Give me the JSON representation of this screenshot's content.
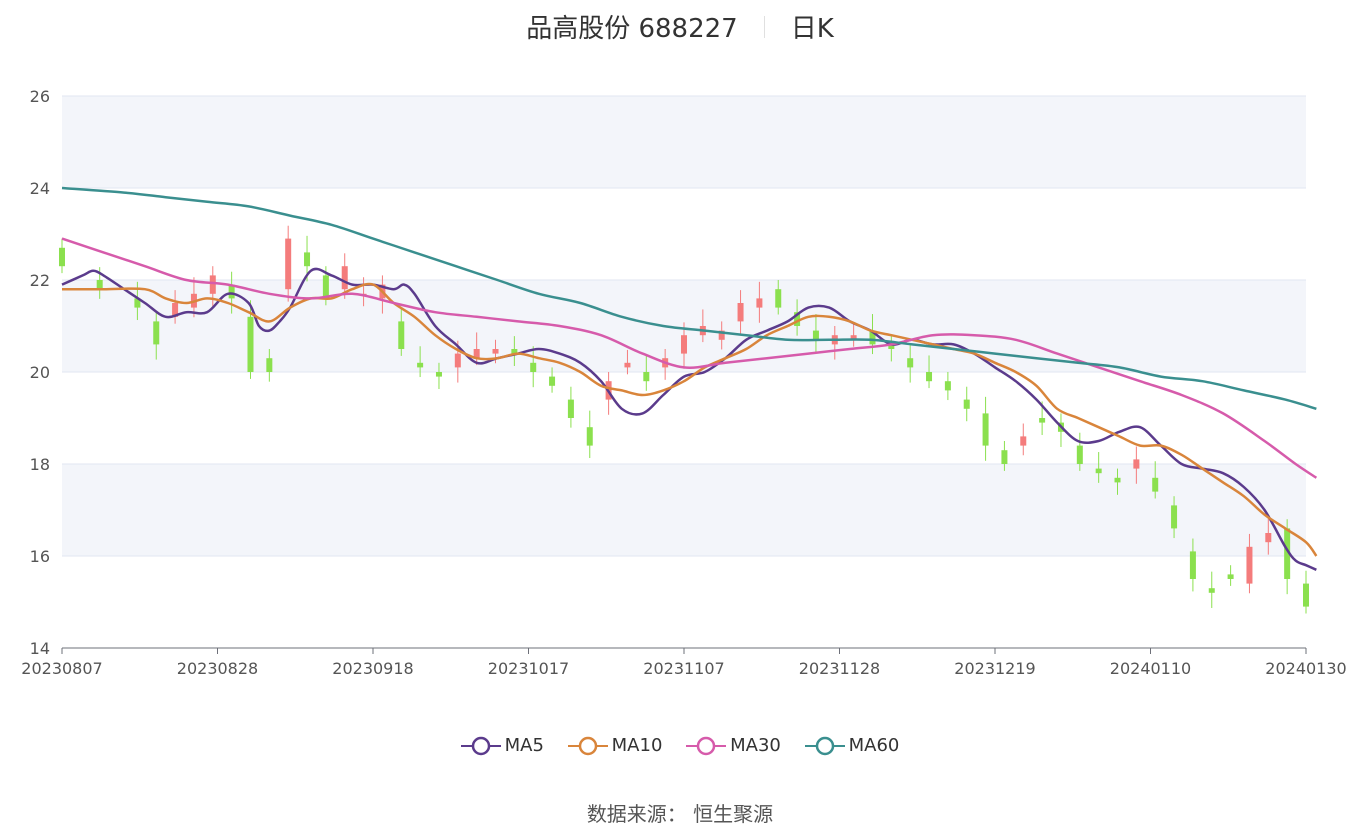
{
  "title": {
    "name": "品高股份 688227",
    "period": "日K"
  },
  "legend": [
    {
      "label": "MA5",
      "color": "#5b3b8c"
    },
    {
      "label": "MA10",
      "color": "#d9853b"
    },
    {
      "label": "MA30",
      "color": "#d65bab"
    },
    {
      "label": "MA60",
      "color": "#3a8f8f"
    }
  ],
  "source": {
    "label": "数据来源：",
    "value": "恒生聚源"
  },
  "colors": {
    "up": "#f47c7c",
    "down": "#8be04e",
    "band": "#f3f5fa",
    "grid": "#e0e6f1"
  },
  "chart_data": {
    "type": "candlestick",
    "ylim": [
      14,
      26
    ],
    "yticks": [
      14,
      16,
      18,
      20,
      22,
      24,
      26
    ],
    "xtick_labels": [
      "20230807",
      "20230828",
      "20230918",
      "20231017",
      "20231107",
      "20231128",
      "20231219",
      "20240110",
      "20240130"
    ],
    "xtick_indices": [
      0,
      15,
      30,
      45,
      60,
      75,
      90,
      105,
      120
    ],
    "num_days": 121,
    "candle_anchors": [
      [
        0,
        22.7,
        22.3
      ],
      [
        4,
        22.0,
        21.8
      ],
      [
        8,
        21.6,
        21.4
      ],
      [
        10,
        21.1,
        20.6
      ],
      [
        12,
        21.2,
        21.5
      ],
      [
        14,
        21.4,
        21.7
      ],
      [
        16,
        21.7,
        22.1
      ],
      [
        18,
        21.9,
        21.6
      ],
      [
        20,
        21.2,
        20.0
      ],
      [
        22,
        20.3,
        20.0
      ],
      [
        24,
        21.8,
        22.9
      ],
      [
        26,
        22.6,
        22.3
      ],
      [
        28,
        22.1,
        21.6
      ],
      [
        30,
        21.8,
        22.3
      ],
      [
        32,
        21.7,
        21.7
      ],
      [
        34,
        21.6,
        21.9
      ],
      [
        36,
        21.1,
        20.5
      ],
      [
        38,
        20.2,
        20.1
      ],
      [
        40,
        20.0,
        19.9
      ],
      [
        42,
        20.1,
        20.4
      ],
      [
        44,
        20.3,
        20.5
      ],
      [
        46,
        20.4,
        20.5
      ],
      [
        48,
        20.5,
        20.4
      ],
      [
        50,
        20.2,
        20.0
      ],
      [
        52,
        19.9,
        19.7
      ],
      [
        54,
        19.4,
        19.0
      ],
      [
        56,
        18.8,
        18.4
      ],
      [
        58,
        19.4,
        19.8
      ],
      [
        60,
        20.1,
        20.2
      ],
      [
        62,
        20.0,
        19.8
      ],
      [
        64,
        20.1,
        20.3
      ],
      [
        66,
        20.4,
        20.8
      ],
      [
        68,
        20.8,
        21.0
      ],
      [
        70,
        20.7,
        20.9
      ],
      [
        72,
        21.1,
        21.5
      ],
      [
        74,
        21.4,
        21.6
      ],
      [
        76,
        21.8,
        21.4
      ],
      [
        78,
        21.3,
        21.0
      ],
      [
        80,
        20.9,
        20.7
      ],
      [
        82,
        20.6,
        20.8
      ],
      [
        84,
        20.7,
        20.8
      ],
      [
        86,
        20.9,
        20.6
      ],
      [
        88,
        20.6,
        20.5
      ],
      [
        90,
        20.3,
        20.1
      ],
      [
        92,
        20.0,
        19.8
      ],
      [
        94,
        19.8,
        19.6
      ],
      [
        96,
        19.4,
        19.2
      ],
      [
        98,
        19.1,
        18.4
      ],
      [
        100,
        18.3,
        18.0
      ],
      [
        102,
        18.4,
        18.6
      ],
      [
        104,
        19.0,
        18.9
      ],
      [
        106,
        18.9,
        18.7
      ],
      [
        108,
        18.4,
        18.0
      ],
      [
        110,
        17.9,
        17.8
      ],
      [
        112,
        17.7,
        17.6
      ],
      [
        114,
        17.9,
        18.1
      ],
      [
        116,
        17.7,
        17.4
      ],
      [
        118,
        17.1,
        16.6
      ],
      [
        120,
        16.1,
        15.5
      ],
      [
        122,
        15.3,
        15.2
      ],
      [
        124,
        15.6,
        15.5
      ],
      [
        126,
        15.4,
        16.2
      ],
      [
        128,
        16.3,
        16.5
      ],
      [
        130,
        16.6,
        15.5
      ],
      [
        132,
        15.4,
        14.9
      ]
    ],
    "series": [
      {
        "name": "MA5",
        "points": [
          [
            0,
            21.9
          ],
          [
            2,
            22.1
          ],
          [
            3,
            22.2
          ],
          [
            4,
            22.1
          ],
          [
            6,
            21.8
          ],
          [
            8,
            21.5
          ],
          [
            10,
            21.2
          ],
          [
            12,
            21.3
          ],
          [
            14,
            21.3
          ],
          [
            16,
            21.7
          ],
          [
            18,
            21.5
          ],
          [
            19,
            21.0
          ],
          [
            20,
            20.9
          ],
          [
            21,
            21.1
          ],
          [
            22,
            21.4
          ],
          [
            24,
            22.2
          ],
          [
            26,
            22.1
          ],
          [
            28,
            21.9
          ],
          [
            30,
            21.9
          ],
          [
            32,
            21.8
          ],
          [
            33,
            21.9
          ],
          [
            34,
            21.7
          ],
          [
            36,
            21.0
          ],
          [
            38,
            20.6
          ],
          [
            40,
            20.2
          ],
          [
            42,
            20.3
          ],
          [
            44,
            20.4
          ],
          [
            46,
            20.5
          ],
          [
            48,
            20.4
          ],
          [
            50,
            20.2
          ],
          [
            52,
            19.8
          ],
          [
            54,
            19.2
          ],
          [
            56,
            19.1
          ],
          [
            58,
            19.5
          ],
          [
            60,
            19.9
          ],
          [
            62,
            20.0
          ],
          [
            64,
            20.3
          ],
          [
            66,
            20.7
          ],
          [
            68,
            20.9
          ],
          [
            70,
            21.1
          ],
          [
            72,
            21.4
          ],
          [
            74,
            21.4
          ],
          [
            76,
            21.1
          ],
          [
            78,
            20.9
          ],
          [
            80,
            20.6
          ],
          [
            82,
            20.7
          ],
          [
            84,
            20.6
          ],
          [
            86,
            20.6
          ],
          [
            88,
            20.4
          ],
          [
            90,
            20.1
          ],
          [
            92,
            19.8
          ],
          [
            94,
            19.4
          ],
          [
            96,
            18.9
          ],
          [
            98,
            18.5
          ],
          [
            100,
            18.5
          ],
          [
            102,
            18.7
          ],
          [
            104,
            18.8
          ],
          [
            106,
            18.4
          ],
          [
            108,
            18.0
          ],
          [
            110,
            17.9
          ],
          [
            112,
            17.8
          ],
          [
            114,
            17.5
          ],
          [
            116,
            17.0
          ],
          [
            118,
            16.2
          ],
          [
            119,
            15.9
          ],
          [
            120,
            15.8
          ],
          [
            121,
            15.7
          ]
        ]
      },
      {
        "name": "MA10",
        "points": [
          [
            0,
            21.8
          ],
          [
            4,
            21.8
          ],
          [
            8,
            21.8
          ],
          [
            10,
            21.6
          ],
          [
            12,
            21.5
          ],
          [
            14,
            21.6
          ],
          [
            16,
            21.5
          ],
          [
            18,
            21.3
          ],
          [
            20,
            21.1
          ],
          [
            22,
            21.4
          ],
          [
            24,
            21.6
          ],
          [
            26,
            21.6
          ],
          [
            28,
            21.8
          ],
          [
            30,
            21.9
          ],
          [
            32,
            21.5
          ],
          [
            34,
            21.2
          ],
          [
            36,
            20.8
          ],
          [
            38,
            20.5
          ],
          [
            40,
            20.3
          ],
          [
            42,
            20.3
          ],
          [
            44,
            20.4
          ],
          [
            46,
            20.3
          ],
          [
            48,
            20.2
          ],
          [
            50,
            20.0
          ],
          [
            52,
            19.7
          ],
          [
            54,
            19.6
          ],
          [
            56,
            19.5
          ],
          [
            58,
            19.6
          ],
          [
            60,
            19.8
          ],
          [
            62,
            20.1
          ],
          [
            64,
            20.3
          ],
          [
            66,
            20.5
          ],
          [
            68,
            20.8
          ],
          [
            70,
            21.0
          ],
          [
            72,
            21.2
          ],
          [
            74,
            21.2
          ],
          [
            76,
            21.1
          ],
          [
            78,
            20.9
          ],
          [
            80,
            20.8
          ],
          [
            82,
            20.7
          ],
          [
            84,
            20.6
          ],
          [
            86,
            20.5
          ],
          [
            88,
            20.4
          ],
          [
            90,
            20.2
          ],
          [
            92,
            20.0
          ],
          [
            94,
            19.7
          ],
          [
            96,
            19.2
          ],
          [
            98,
            19.0
          ],
          [
            100,
            18.8
          ],
          [
            102,
            18.6
          ],
          [
            104,
            18.4
          ],
          [
            106,
            18.4
          ],
          [
            108,
            18.2
          ],
          [
            110,
            17.9
          ],
          [
            112,
            17.6
          ],
          [
            114,
            17.3
          ],
          [
            116,
            16.9
          ],
          [
            118,
            16.6
          ],
          [
            120,
            16.3
          ],
          [
            121,
            16.0
          ]
        ]
      },
      {
        "name": "MA30",
        "points": [
          [
            0,
            22.9
          ],
          [
            4,
            22.6
          ],
          [
            8,
            22.3
          ],
          [
            12,
            22.0
          ],
          [
            16,
            21.9
          ],
          [
            20,
            21.7
          ],
          [
            24,
            21.6
          ],
          [
            28,
            21.7
          ],
          [
            32,
            21.5
          ],
          [
            36,
            21.3
          ],
          [
            40,
            21.2
          ],
          [
            44,
            21.1
          ],
          [
            48,
            21.0
          ],
          [
            52,
            20.8
          ],
          [
            56,
            20.4
          ],
          [
            60,
            20.1
          ],
          [
            64,
            20.2
          ],
          [
            68,
            20.3
          ],
          [
            72,
            20.4
          ],
          [
            76,
            20.5
          ],
          [
            80,
            20.6
          ],
          [
            84,
            20.8
          ],
          [
            88,
            20.8
          ],
          [
            92,
            20.7
          ],
          [
            96,
            20.4
          ],
          [
            100,
            20.1
          ],
          [
            104,
            19.8
          ],
          [
            108,
            19.5
          ],
          [
            112,
            19.1
          ],
          [
            116,
            18.5
          ],
          [
            119,
            18.0
          ],
          [
            121,
            17.7
          ]
        ]
      },
      {
        "name": "MA60",
        "points": [
          [
            0,
            24.0
          ],
          [
            6,
            23.9
          ],
          [
            10,
            23.8
          ],
          [
            14,
            23.7
          ],
          [
            18,
            23.6
          ],
          [
            22,
            23.4
          ],
          [
            26,
            23.2
          ],
          [
            30,
            22.9
          ],
          [
            34,
            22.6
          ],
          [
            38,
            22.3
          ],
          [
            42,
            22.0
          ],
          [
            46,
            21.7
          ],
          [
            50,
            21.5
          ],
          [
            54,
            21.2
          ],
          [
            58,
            21.0
          ],
          [
            62,
            20.9
          ],
          [
            66,
            20.8
          ],
          [
            70,
            20.7
          ],
          [
            74,
            20.7
          ],
          [
            78,
            20.7
          ],
          [
            82,
            20.6
          ],
          [
            86,
            20.5
          ],
          [
            90,
            20.4
          ],
          [
            94,
            20.3
          ],
          [
            98,
            20.2
          ],
          [
            102,
            20.1
          ],
          [
            106,
            19.9
          ],
          [
            110,
            19.8
          ],
          [
            114,
            19.6
          ],
          [
            118,
            19.4
          ],
          [
            121,
            19.2
          ]
        ]
      }
    ]
  }
}
